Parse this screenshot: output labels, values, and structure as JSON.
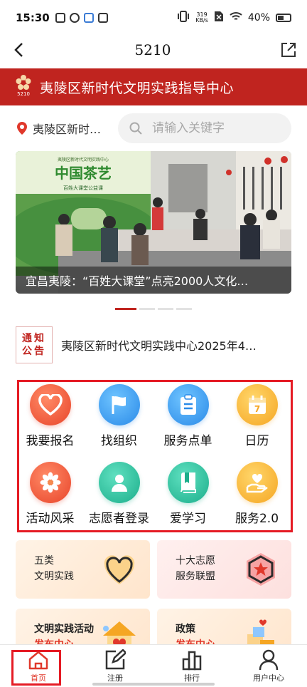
{
  "status_bar": {
    "time": "15:30",
    "net_speed_value": "319",
    "net_speed_unit": "KB/s",
    "battery": "40%"
  },
  "title_bar": {
    "title": "5210",
    "back_icon": "chevron-left-icon",
    "share_icon": "share-external-icon"
  },
  "org_header": {
    "logo_text": "5210",
    "title": "夷陵区新时代文明实践指导中心",
    "bg_color": "#c0241f"
  },
  "search": {
    "location": "夷陵区新时…",
    "placeholder": "请输入关键字"
  },
  "carousel": {
    "caption": "宜昌夷陵：“百姓大课堂”点亮2000人文化…",
    "slide_title": "中国茶艺",
    "slide_subtitle": "百姓大课堂公益课",
    "slide_top_text": "夷陵区新时代文明实践中心",
    "slide_count": 4,
    "active_index": 0
  },
  "notice": {
    "badge_line1": "通知",
    "badge_line2": "公告",
    "text": "夷陵区新时代文明实践中心2025年4…"
  },
  "grid": [
    {
      "label": "我要报名",
      "icon": "heart-icon",
      "color": "red"
    },
    {
      "label": "找组织",
      "icon": "flag-icon",
      "color": "blue"
    },
    {
      "label": "服务点单",
      "icon": "clipboard-icon",
      "color": "blue"
    },
    {
      "label": "日历",
      "icon": "calendar-icon",
      "color": "yellow",
      "day": "7"
    },
    {
      "label": "活动风采",
      "icon": "flower-icon",
      "color": "red"
    },
    {
      "label": "志愿者登录",
      "icon": "person-icon",
      "color": "teal"
    },
    {
      "label": "爱学习",
      "icon": "book-icon",
      "color": "teal"
    },
    {
      "label": "服务2.0",
      "icon": "hand-heart-icon",
      "color": "yellow"
    }
  ],
  "cards": [
    {
      "line1": "五类",
      "line2": "文明实践",
      "icon": "heart-outline-icon"
    },
    {
      "line1": "十大志愿",
      "line2": "服务联盟",
      "icon": "star-badge-icon"
    },
    {
      "line1": "文明实践活动",
      "line2": "发布中心",
      "icon": "house-heart-icon"
    },
    {
      "line1": "政策",
      "line2": "发布中心",
      "icon": "gift-boxes-icon"
    }
  ],
  "bottom_nav": [
    {
      "label": "首页",
      "icon": "home-icon",
      "active": true
    },
    {
      "label": "注册",
      "icon": "edit-icon",
      "active": false
    },
    {
      "label": "排行",
      "icon": "ranking-icon",
      "active": false
    },
    {
      "label": "用户中心",
      "icon": "user-icon",
      "active": false
    }
  ],
  "colors": {
    "accent": "#c0241f",
    "highlight": "#e51b24"
  }
}
